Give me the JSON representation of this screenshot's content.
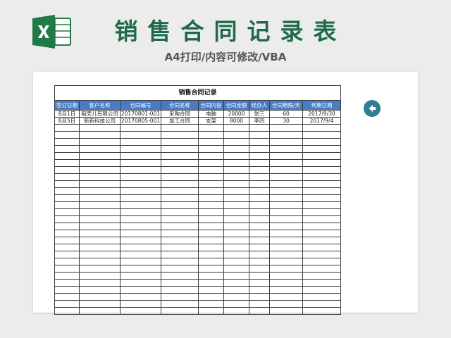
{
  "header": {
    "title": "销售合同记录表",
    "subtitle": "A4打印/内容可修改/VBA",
    "logo_icon": "excel-logo-icon",
    "accent_color": "#1f6b48"
  },
  "sheet": {
    "table_title": "销售合同记录",
    "header_color": "#4a7cc4",
    "columns": [
      "签订日期",
      "客户名称",
      "合同编号",
      "合同名称",
      "合同内容",
      "合同金额",
      "经办人",
      "合同期限/天",
      "到期日期"
    ],
    "rows": [
      [
        "8月1日",
        "稻壳儿有限公司",
        "20170801-001",
        "采购合同",
        "电脑",
        "20000",
        "张三",
        "60",
        "2017/9/30"
      ],
      [
        "8月5日",
        "新新科技公司",
        "20170805-001",
        "加工合同",
        "支架",
        "8000",
        "李四",
        "30",
        "2017/9/4"
      ]
    ],
    "empty_rows": 27,
    "back_button_icon": "arrow-left-icon"
  }
}
